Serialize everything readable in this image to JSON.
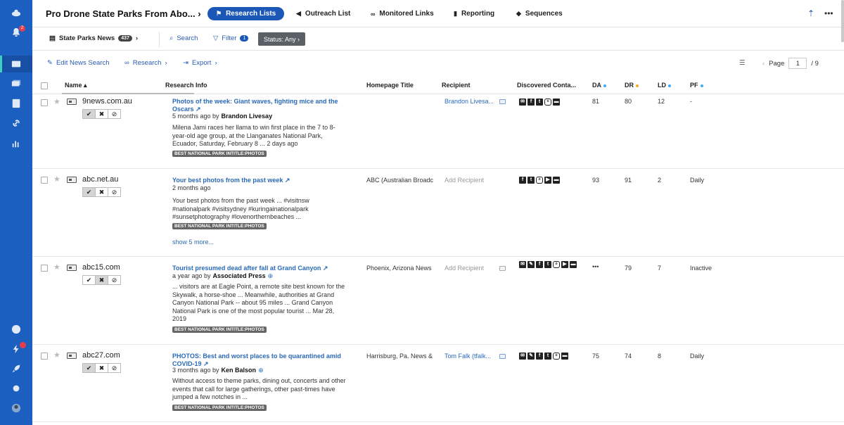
{
  "sidebar": {
    "notification_count": "2"
  },
  "header": {
    "project_title": "Pro Drone State Parks From Abo...",
    "tabs": [
      {
        "label": "Research Lists",
        "active": true
      },
      {
        "label": "Outreach List"
      },
      {
        "label": "Monitored Links"
      },
      {
        "label": "Reporting"
      },
      {
        "label": "Sequences"
      }
    ]
  },
  "subbar": {
    "list_name": "State Parks News",
    "list_count": "437",
    "search_label": "Search",
    "filter_label": "Filter",
    "filter_count": "1",
    "status_label": "Status: Any"
  },
  "toolbar": {
    "edit_label": "Edit News Search",
    "research_label": "Research",
    "export_label": "Export",
    "page_label": "Page",
    "page_current": "1",
    "page_total": "/ 9"
  },
  "columns": {
    "name": "Name",
    "research_info": "Research Info",
    "homepage_title": "Homepage Title",
    "recipient": "Recipient",
    "discovered": "Discovered Conta...",
    "da": "DA",
    "dr": "DR",
    "ld": "LD",
    "pf": "PF"
  },
  "rows": [
    {
      "domain": "9news.com.au",
      "title": "Photos of the week: Giant waves, fighting mice and the Oscars",
      "meta_time": "5 months ago by",
      "meta_author": "Brandon Livesay",
      "snippet": "Milena Jami races her llama to win first place in the 7 to 8-year-old age group, at the Llanganates National Park, Ecuador, Saturday, February 8 ... 2 days ago",
      "tag": "BEST NATIONAL PARK INTITLE:PHOTOS",
      "homepage": "",
      "recipient": "Brandon Livesa...",
      "da": "81",
      "dr": "80",
      "ld": "12",
      "pf": "-"
    },
    {
      "domain": "abc.net.au",
      "title": "Your best photos from the past week",
      "meta_time": "2 months ago",
      "snippet": "Your best photos from the past week ... #visitnsw #nationalpark #visitsydney #kuringainationalpark #sunsetphotography #lovenorthernbeaches ...",
      "tag": "BEST NATIONAL PARK INTITLE:PHOTOS",
      "show_more": "show 5 more...",
      "homepage": "ABC (Australian Broadc",
      "recipient": "Add Recipient",
      "da": "93",
      "dr": "91",
      "ld": "2",
      "pf": "Daily"
    },
    {
      "domain": "abc15.com",
      "title": "Tourist presumed dead after fall at Grand Canyon",
      "meta_time": "a year ago by",
      "meta_author": "Associated Press",
      "snippet": "... visitors are at Eagle Point, a remote site best known for the Skywalk, a horse-shoe ... Meanwhile, authorities at Grand Canyon National Park -- about 95 miles ... Grand Canyon National Park is one of the most popular tourist ... Mar 28, 2019",
      "tag": "BEST NATIONAL PARK INTITLE:PHOTOS",
      "homepage": "Phoenix, Arizona News",
      "recipient": "Add Recipient",
      "da": "•••",
      "dr": "79",
      "ld": "7",
      "pf": "Inactive"
    },
    {
      "domain": "abc27.com",
      "title": "PHOTOS: Best and worst places to be quarantined amid COVID-19",
      "meta_time": "3 months ago by",
      "meta_author": "Ken Balson",
      "snippet": "Without access to theme parks, dining out, concerts and other events that call for large gatherings, other past-times have jumped a few notches in ...",
      "tag": "BEST NATIONAL PARK INTITLE:PHOTOS",
      "homepage": "Harrisburg, Pa. News &",
      "recipient": "Tom Falk (tfalk...",
      "da": "75",
      "dr": "74",
      "ld": "8",
      "pf": "Daily"
    }
  ]
}
